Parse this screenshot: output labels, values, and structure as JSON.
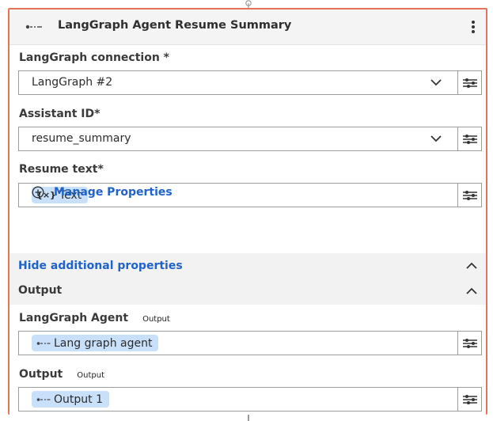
{
  "node": {
    "title": "LangGraph Agent Resume Summary",
    "icon": "agent-link-icon",
    "menu_icon": "kebab-menu-icon"
  },
  "fields": {
    "connection": {
      "label": "LangGraph connection *",
      "value": "LangGraph #2"
    },
    "assistant": {
      "label": "Assistant ID*",
      "value": "resume_summary"
    },
    "resume_text": {
      "label": "Resume text*",
      "chip": "Text",
      "chip_icon": "{×}"
    }
  },
  "manage_properties": {
    "label": "Manage Properties",
    "icon": "plus-circle-icon"
  },
  "additional": {
    "hide_label": "Hide additional properties"
  },
  "output_section": {
    "heading": "Output",
    "agent": {
      "label": "LangGraph Agent",
      "sublabel": "Output",
      "chip": "Lang graph agent"
    },
    "output": {
      "label": "Output",
      "sublabel": "Output",
      "chip": "Output 1"
    }
  },
  "colors": {
    "accent": "#1f62c8",
    "border": "#e2735c",
    "chip": "#c9e0fb"
  }
}
